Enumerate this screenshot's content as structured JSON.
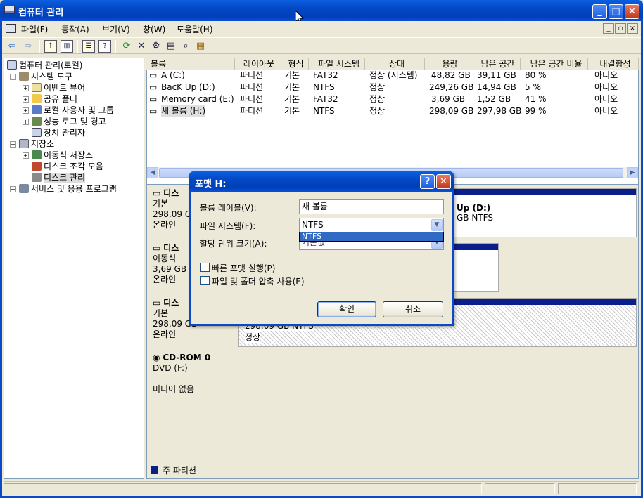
{
  "window": {
    "title": "컴퓨터 관리",
    "minimize": "_",
    "maximize": "□",
    "close": "✕"
  },
  "menu": [
    "파일(F)",
    "동작(A)",
    "보기(V)",
    "창(W)",
    "도움말(H)"
  ],
  "mdi_controls": [
    "_",
    "▫",
    "×"
  ],
  "toolbar_icons": [
    "back-arrow-icon",
    "forward-arrow-icon",
    "up-folder-icon",
    "show-hide-tree-icon",
    "properties-icon",
    "help-icon",
    "refresh-icon",
    "delete-icon",
    "settings-icon",
    "search-icon",
    "export-icon"
  ],
  "tree": [
    {
      "label": "컴퓨터 관리(로컬)",
      "level": 0,
      "expander": ""
    },
    {
      "label": "시스템 도구",
      "level": 1,
      "expander": "−"
    },
    {
      "label": "이벤트 뷰어",
      "level": 2,
      "expander": "+"
    },
    {
      "label": "공유 폴더",
      "level": 2,
      "expander": "+"
    },
    {
      "label": "로컬 사용자 및 그룹",
      "level": 2,
      "expander": "+"
    },
    {
      "label": "성능 로그 및 경고",
      "level": 2,
      "expander": "+"
    },
    {
      "label": "장치 관리자",
      "level": 2,
      "expander": ""
    },
    {
      "label": "저장소",
      "level": 1,
      "expander": "−"
    },
    {
      "label": "이동식 저장소",
      "level": 2,
      "expander": "+"
    },
    {
      "label": "디스크 조각 모음",
      "level": 2,
      "expander": ""
    },
    {
      "label": "디스크 관리",
      "level": 2,
      "expander": "",
      "selected": true
    },
    {
      "label": "서비스 및 응용 프로그램",
      "level": 1,
      "expander": "+"
    }
  ],
  "volume_list": {
    "headers": [
      "볼륨",
      "레이아웃",
      "형식",
      "파일 시스템",
      "상태",
      "용량",
      "남은 공간",
      "남은 공간 비율",
      "내결함성"
    ],
    "rows": [
      [
        "A (C:)",
        "파티션",
        "기본",
        "FAT32",
        "정상 (시스템)",
        "48,82 GB",
        "39,11 GB",
        "80 %",
        "아니오"
      ],
      [
        "BacK Up (D:)",
        "파티션",
        "기본",
        "NTFS",
        "정상",
        "249,26 GB",
        "14,94 GB",
        "5 %",
        "아니오"
      ],
      [
        "Memory card (E:)",
        "파티션",
        "기본",
        "FAT32",
        "정상",
        "3,69 GB",
        "1,52 GB",
        "41 %",
        "아니오"
      ],
      [
        "새 볼륨 (H:)",
        "파티션",
        "기본",
        "NTFS",
        "정상",
        "298,09 GB",
        "297,98 GB",
        "99 %",
        "아니오"
      ]
    ]
  },
  "disks": [
    {
      "name": "디스",
      "type": "기본",
      "size": "298,09 GB",
      "state": "온라인",
      "partition_title": "Up  (D:)",
      "partition_info": "GB NTFS"
    },
    {
      "name": "디스",
      "type": "이동식",
      "size": "3,69 GB",
      "state": "온라인"
    },
    {
      "name": "디스",
      "type": "기본",
      "size": "298,09 GB",
      "state": "온라인",
      "partition_info": "298,09 GB NTFS",
      "partition_status": "정상"
    },
    {
      "name": "CD-ROM 0",
      "type": "DVD (F:)",
      "state": "미디어 없음"
    }
  ],
  "legend": {
    "primary_partition": "주 파티션"
  },
  "colors": {
    "title_blue": "#0348c4",
    "primary_partition": "#0b1f8a",
    "dialog_close": "#c4371b"
  },
  "format_dialog": {
    "title": "포맷 H:",
    "help": "?",
    "close": "✕",
    "volume_label_label": "볼륨 레이블(V):",
    "volume_label_value": "새 볼륨",
    "file_system_label": "파일 시스템(F):",
    "file_system_value": "NTFS",
    "file_system_dropdown_option": "NTFS",
    "allocation_label": "할당 단위 크기(A):",
    "allocation_value": "기본값",
    "quick_format_label": "빠른 포맷 실행(P)",
    "compression_label": "파일 및 폴더 압축 사용(E)",
    "ok": "확인",
    "cancel": "취소"
  }
}
